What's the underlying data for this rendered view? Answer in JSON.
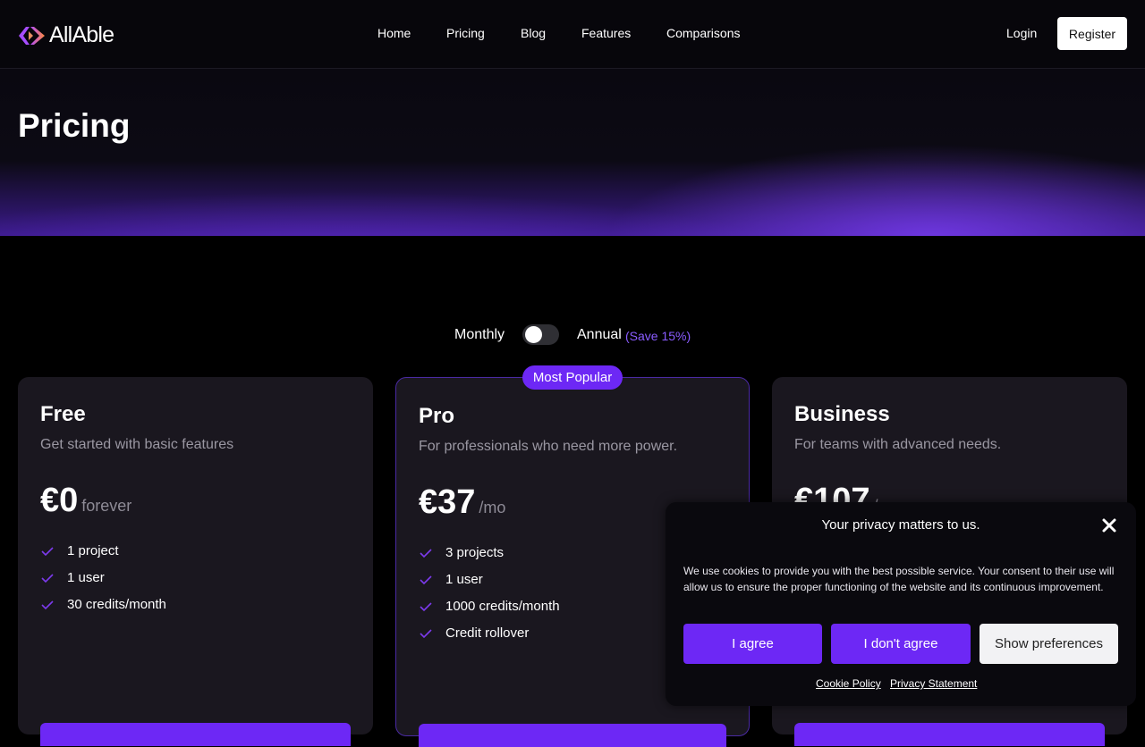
{
  "header": {
    "logo_text": "AllAble",
    "nav": [
      "Home",
      "Pricing",
      "Blog",
      "Features",
      "Comparisons"
    ],
    "login": "Login",
    "register": "Register"
  },
  "hero": {
    "title": "Pricing"
  },
  "billing": {
    "monthly": "Monthly",
    "annual": "Annual",
    "save": "(Save 15%)",
    "annual_selected": false
  },
  "plans": [
    {
      "name": "Free",
      "desc": "Get started with basic features",
      "price": "€0",
      "period": "forever",
      "features": [
        "1 project",
        "1 user",
        "30 credits/month"
      ]
    },
    {
      "name": "Pro",
      "desc": "For professionals who need more power.",
      "price": "€37",
      "period": "/mo",
      "badge": "Most Popular",
      "features": [
        "3 projects",
        "1 user",
        "1000 credits/month",
        "Credit rollover"
      ]
    },
    {
      "name": "Business",
      "desc": "For teams with advanced needs.",
      "price": "€107",
      "period": "/"
    }
  ],
  "cookie": {
    "title": "Your privacy matters to us.",
    "text": "We use cookies to provide you with the best possible service. Your consent to their use will allow us to ensure the proper functioning of the website and its continuous improvement.",
    "agree": "I agree",
    "disagree": "I don't agree",
    "preferences": "Show preferences",
    "cookie_policy": "Cookie Policy",
    "privacy_statement": "Privacy Statement"
  },
  "colors": {
    "accent": "#6d28f5",
    "save_text": "#8a5cff",
    "card_bg": "#1a171f"
  },
  "icons": {
    "logo": "allable-logo",
    "check": "check-icon",
    "close": "close-icon"
  }
}
